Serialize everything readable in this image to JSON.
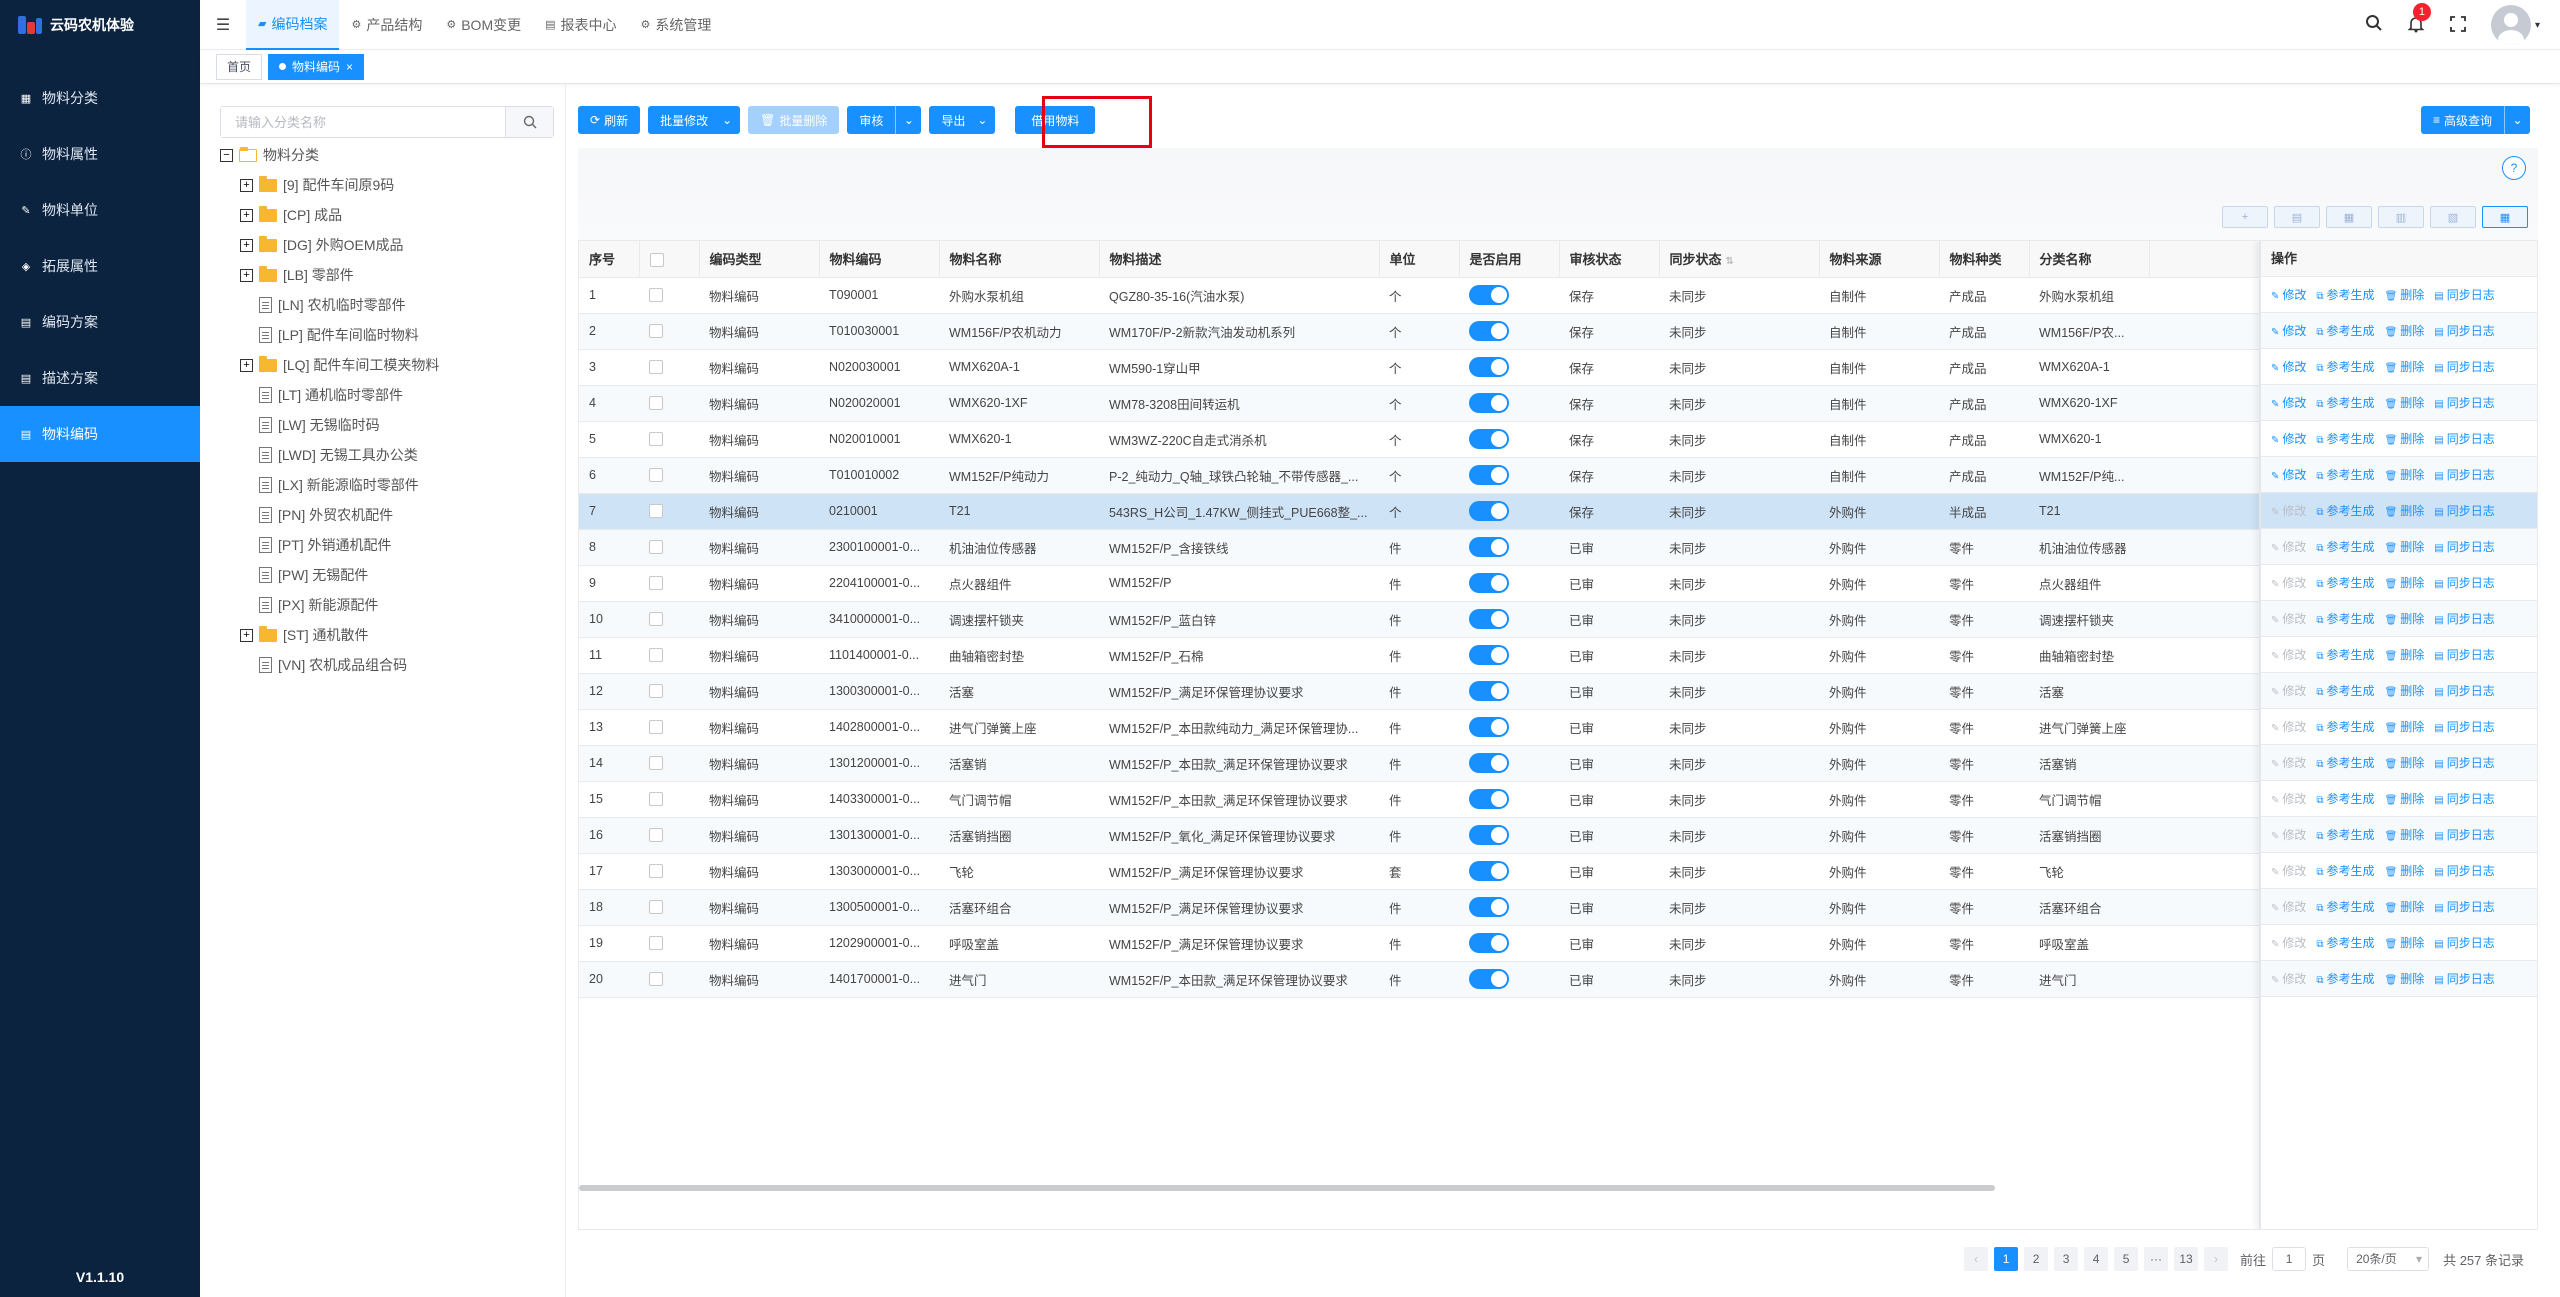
{
  "app": {
    "name": "云码农机体验",
    "version": "V1.1.10"
  },
  "sidebar": {
    "items": [
      {
        "label": "物料分类",
        "icon": "grid-icon"
      },
      {
        "label": "物料属性",
        "icon": "info-icon"
      },
      {
        "label": "物料单位",
        "icon": "pencil-icon"
      },
      {
        "label": "拓展属性",
        "icon": "layers-icon"
      },
      {
        "label": "编码方案",
        "icon": "doc-icon"
      },
      {
        "label": "描述方案",
        "icon": "doc-icon"
      },
      {
        "label": "物料编码",
        "icon": "doc-icon",
        "active": true
      }
    ]
  },
  "topnav": {
    "tabs": [
      {
        "label": "编码档案",
        "icon": "folder-icon",
        "active": true
      },
      {
        "label": "产品结构",
        "icon": "gear-icon"
      },
      {
        "label": "BOM变更",
        "icon": "gear-icon"
      },
      {
        "label": "报表中心",
        "icon": "report-icon"
      },
      {
        "label": "系统管理",
        "icon": "gear-icon"
      }
    ],
    "notification_count": "1"
  },
  "tags": {
    "home": "首页",
    "current": "物料编码",
    "close": "×"
  },
  "tree": {
    "search_placeholder": "请输入分类名称",
    "root": "物料分类",
    "nodes": [
      {
        "label": "[9] 配件车间原9码",
        "type": "folder"
      },
      {
        "label": "[CP] 成品",
        "type": "folder"
      },
      {
        "label": "[DG] 外购OEM成品",
        "type": "folder"
      },
      {
        "label": "[LB] 零部件",
        "type": "folder"
      },
      {
        "label": "[LN] 农机临时零部件",
        "type": "file"
      },
      {
        "label": "[LP] 配件车间临时物料",
        "type": "file"
      },
      {
        "label": "[LQ] 配件车间工模夹物料",
        "type": "folder"
      },
      {
        "label": "[LT] 通机临时零部件",
        "type": "file"
      },
      {
        "label": "[LW] 无锡临时码",
        "type": "file"
      },
      {
        "label": "[LWD] 无锡工具办公类",
        "type": "file"
      },
      {
        "label": "[LX] 新能源临时零部件",
        "type": "file"
      },
      {
        "label": "[PN] 外贸农机配件",
        "type": "file"
      },
      {
        "label": "[PT] 外销通机配件",
        "type": "file"
      },
      {
        "label": "[PW] 无锡配件",
        "type": "file"
      },
      {
        "label": "[PX] 新能源配件",
        "type": "file"
      },
      {
        "label": "[ST] 通机散件",
        "type": "folder"
      },
      {
        "label": "[VN] 农机成品组合码",
        "type": "file"
      }
    ]
  },
  "toolbar": {
    "refresh": "刷新",
    "batch_edit": "批量修改",
    "batch_delete": "批量删除",
    "audit": "审核",
    "export": "导出",
    "loan": "借用物料",
    "advanced_search": "高级查询"
  },
  "table": {
    "columns": [
      "序号",
      "",
      "编码类型",
      "物料编码",
      "物料名称",
      "物料描述",
      "单位",
      "是否启用",
      "审核状态",
      "同步状态",
      "物料来源",
      "物料种类",
      "分类名称"
    ],
    "ops_header": "操作",
    "ops_labels": [
      "修改",
      "参考生成",
      "删除",
      "同步日志"
    ],
    "rows": [
      [
        "1",
        "物料编码",
        "T090001",
        "外购水泵机组",
        "QGZ80-35-16(汽油水泵)",
        "个",
        "保存",
        "未同步",
        "自制件",
        "产成品",
        "外购水泵机组"
      ],
      [
        "2",
        "物料编码",
        "T010030001",
        "WM156F/P农机动力",
        "WM170F/P-2新款汽油发动机系列",
        "个",
        "保存",
        "未同步",
        "自制件",
        "产成品",
        "WM156F/P农..."
      ],
      [
        "3",
        "物料编码",
        "N020030001",
        "WMX620A-1",
        "WM590-1穿山甲",
        "个",
        "保存",
        "未同步",
        "自制件",
        "产成品",
        "WMX620A-1"
      ],
      [
        "4",
        "物料编码",
        "N020020001",
        "WMX620-1XF",
        "WM78-3208田间转运机",
        "个",
        "保存",
        "未同步",
        "自制件",
        "产成品",
        "WMX620-1XF"
      ],
      [
        "5",
        "物料编码",
        "N020010001",
        "WMX620-1",
        "WM3WZ-220C自走式消杀机",
        "个",
        "保存",
        "未同步",
        "自制件",
        "产成品",
        "WMX620-1"
      ],
      [
        "6",
        "物料编码",
        "T010010002",
        "WM152F/P纯动力",
        "P-2_纯动力_Q轴_球铁凸轮轴_不带传感器_...",
        "个",
        "保存",
        "未同步",
        "自制件",
        "产成品",
        "WM152F/P纯..."
      ],
      [
        "7",
        "物料编码",
        "0210001",
        "T21",
        "543RS_H公司_1.47KW_侧挂式_PUE668整_...",
        "个",
        "保存",
        "未同步",
        "外购件",
        "半成品",
        "T21"
      ],
      [
        "8",
        "物料编码",
        "2300100001-0...",
        "机油油位传感器",
        "WM152F/P_含接铁线",
        "件",
        "已审",
        "未同步",
        "外购件",
        "零件",
        "机油油位传感器"
      ],
      [
        "9",
        "物料编码",
        "2204100001-0...",
        "点火器组件",
        "WM152F/P",
        "件",
        "已审",
        "未同步",
        "外购件",
        "零件",
        "点火器组件"
      ],
      [
        "10",
        "物料编码",
        "3410000001-0...",
        "调速摆杆锁夹",
        "WM152F/P_蓝白锌",
        "件",
        "已审",
        "未同步",
        "外购件",
        "零件",
        "调速摆杆锁夹"
      ],
      [
        "11",
        "物料编码",
        "1101400001-0...",
        "曲轴箱密封垫",
        "WM152F/P_石棉",
        "件",
        "已审",
        "未同步",
        "外购件",
        "零件",
        "曲轴箱密封垫"
      ],
      [
        "12",
        "物料编码",
        "1300300001-0...",
        "活塞",
        "WM152F/P_满足环保管理协议要求",
        "件",
        "已审",
        "未同步",
        "外购件",
        "零件",
        "活塞"
      ],
      [
        "13",
        "物料编码",
        "1402800001-0...",
        "进气门弹簧上座",
        "WM152F/P_本田款纯动力_满足环保管理协...",
        "件",
        "已审",
        "未同步",
        "外购件",
        "零件",
        "进气门弹簧上座"
      ],
      [
        "14",
        "物料编码",
        "1301200001-0...",
        "活塞销",
        "WM152F/P_本田款_满足环保管理协议要求",
        "件",
        "已审",
        "未同步",
        "外购件",
        "零件",
        "活塞销"
      ],
      [
        "15",
        "物料编码",
        "1403300001-0...",
        "气门调节帽",
        "WM152F/P_本田款_满足环保管理协议要求",
        "件",
        "已审",
        "未同步",
        "外购件",
        "零件",
        "气门调节帽"
      ],
      [
        "16",
        "物料编码",
        "1301300001-0...",
        "活塞销挡圈",
        "WM152F/P_氧化_满足环保管理协议要求",
        "件",
        "已审",
        "未同步",
        "外购件",
        "零件",
        "活塞销挡圈"
      ],
      [
        "17",
        "物料编码",
        "1303000001-0...",
        "飞轮",
        "WM152F/P_满足环保管理协议要求",
        "套",
        "已审",
        "未同步",
        "外购件",
        "零件",
        "飞轮"
      ],
      [
        "18",
        "物料编码",
        "1300500001-0...",
        "活塞环组合",
        "WM152F/P_满足环保管理协议要求",
        "件",
        "已审",
        "未同步",
        "外购件",
        "零件",
        "活塞环组合"
      ],
      [
        "19",
        "物料编码",
        "1202900001-0...",
        "呼吸室盖",
        "WM152F/P_满足环保管理协议要求",
        "件",
        "已审",
        "未同步",
        "外购件",
        "零件",
        "呼吸室盖"
      ],
      [
        "20",
        "物料编码",
        "1401700001-0...",
        "进气门",
        "WM152F/P_本田款_满足环保管理协议要求",
        "件",
        "已审",
        "未同步",
        "外购件",
        "零件",
        "进气门"
      ]
    ]
  },
  "pagination": {
    "pages": [
      "1",
      "2",
      "3",
      "4",
      "5",
      "···",
      "13"
    ],
    "current": "1",
    "goto_prefix": "前往",
    "goto_value": "1",
    "goto_suffix": "页",
    "page_size": "20条/页",
    "total": "共 257 条记录"
  },
  "colors": {
    "primary": "#1890ff",
    "sidebar": "#0c2340",
    "highlight": "#e60012"
  }
}
